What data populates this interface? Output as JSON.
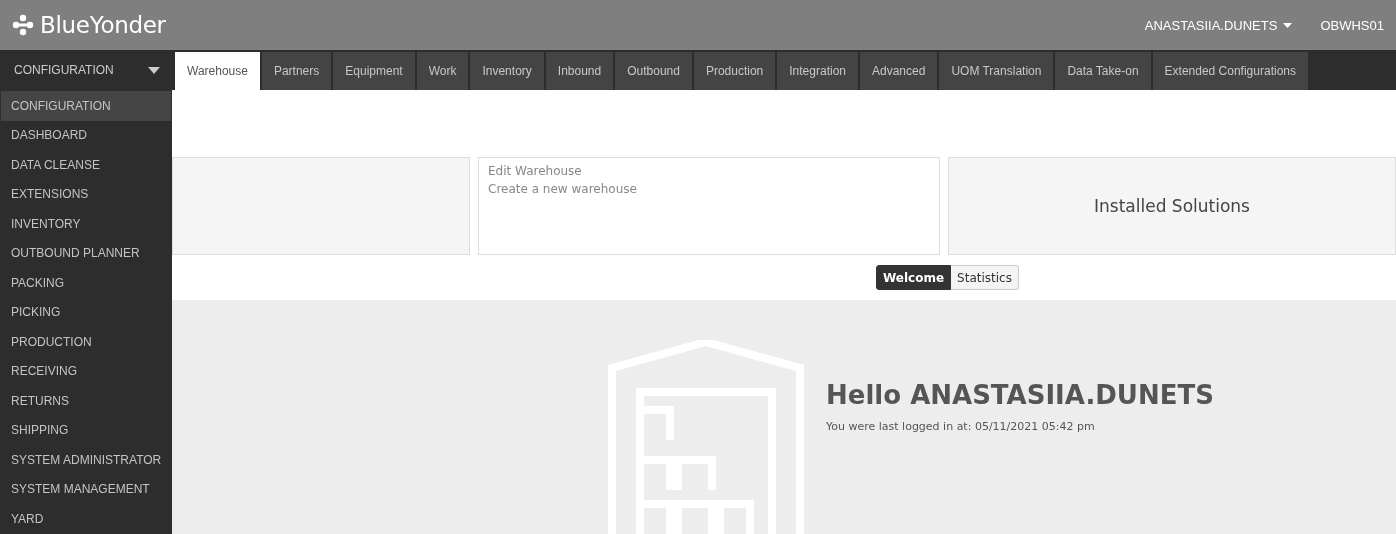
{
  "header": {
    "logo": "BlueYonder",
    "user": "ANASTASIIA.DUNETS",
    "warehouse": "OBWHS01"
  },
  "module_menu": {
    "label": "CONFIGURATION",
    "expanded": true,
    "items": [
      {
        "label": "CONFIGURATION",
        "selected": true
      },
      {
        "label": "DASHBOARD",
        "selected": false
      },
      {
        "label": "DATA CLEANSE",
        "selected": false
      },
      {
        "label": "EXTENSIONS",
        "selected": false
      },
      {
        "label": "INVENTORY",
        "selected": false
      },
      {
        "label": "OUTBOUND PLANNER",
        "selected": false
      },
      {
        "label": "PACKING",
        "selected": false
      },
      {
        "label": "PICKING",
        "selected": false
      },
      {
        "label": "PRODUCTION",
        "selected": false
      },
      {
        "label": "RECEIVING",
        "selected": false
      },
      {
        "label": "RETURNS",
        "selected": false
      },
      {
        "label": "SHIPPING",
        "selected": false
      },
      {
        "label": "SYSTEM ADMINISTRATOR",
        "selected": false
      },
      {
        "label": "SYSTEM MANAGEMENT",
        "selected": false
      },
      {
        "label": "YARD",
        "selected": false
      }
    ]
  },
  "tabs": [
    {
      "label": "Warehouse",
      "selected": true
    },
    {
      "label": "Partners",
      "selected": false
    },
    {
      "label": "Equipment",
      "selected": false
    },
    {
      "label": "Work",
      "selected": false
    },
    {
      "label": "Inventory",
      "selected": false
    },
    {
      "label": "Inbound",
      "selected": false
    },
    {
      "label": "Outbound",
      "selected": false
    },
    {
      "label": "Production",
      "selected": false
    },
    {
      "label": "Integration",
      "selected": false
    },
    {
      "label": "Advanced",
      "selected": false
    },
    {
      "label": "UOM Translation",
      "selected": false
    },
    {
      "label": "Data Take-on",
      "selected": false
    },
    {
      "label": "Extended Configurations",
      "selected": false
    }
  ],
  "cards": [
    {
      "kind": "blank"
    },
    {
      "kind": "links",
      "lines": [
        "Edit Warehouse",
        "Create a new warehouse"
      ]
    },
    {
      "kind": "title",
      "title": "Installed Solutions"
    }
  ],
  "view_toggle": [
    {
      "label": "Welcome",
      "selected": true
    },
    {
      "label": "Statistics",
      "selected": false
    }
  ],
  "welcome": {
    "greeting": "Hello ANASTASIIA.DUNETS",
    "last_login": "You were last logged in at: 05/11/2021 05:42 pm"
  }
}
